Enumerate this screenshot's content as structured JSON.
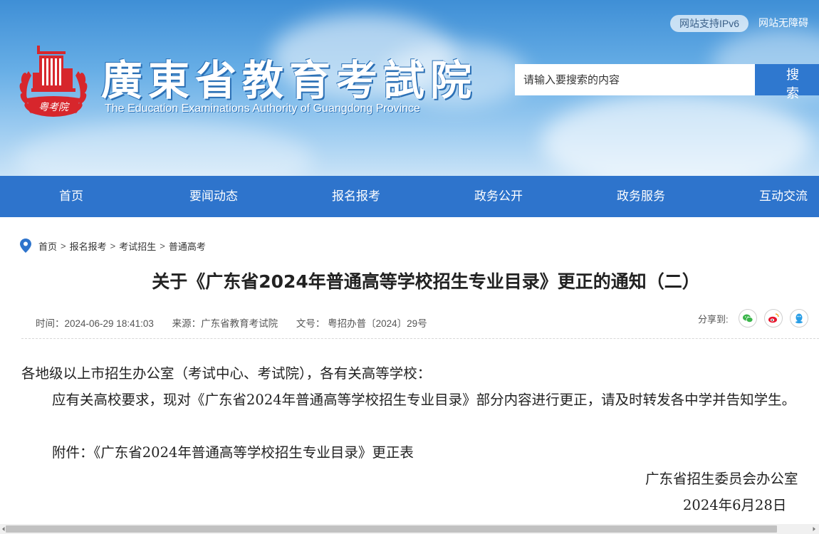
{
  "header": {
    "site_name_cn": "廣東省教育考試院",
    "site_name_en": "The Education Examinations Authority of Guangdong Province",
    "emblem_text": "粤考院",
    "ipv6_label": "网站支持IPv6",
    "accessibility_label": "网站无障碍",
    "search_placeholder": "请输入要搜索的内容",
    "search_button": "搜 索"
  },
  "nav": {
    "items": [
      "首页",
      "要闻动态",
      "报名报考",
      "政务公开",
      "政务服务",
      "互动交流"
    ]
  },
  "breadcrumb": {
    "items": [
      "首页",
      "报名报考",
      "考试招生",
      "普通高考"
    ],
    "separator": ">"
  },
  "article": {
    "title": "关于《广东省2024年普通高等学校招生专业目录》更正的通知（二）",
    "time": "时间：2024-06-29 18:41:03",
    "source": "来源：广东省教育考试院",
    "doc_no": "文号： 粤招办普〔2024〕29号",
    "share_label": "分享到:",
    "share_icons": [
      "wechat-icon",
      "weibo-icon",
      "qq-icon"
    ],
    "salutation": "各地级以上市招生办公室（考试中心、考试院），各有关高等学校：",
    "paragraph": "应有关高校要求，现对《广东省2024年普通高等学校招生专业目录》部分内容进行更正，请及时转发各中学并告知学生。",
    "attachment": "附件：《广东省2024年普通高等学校招生专业目录》更正表",
    "signature": "广东省招生委员会办公室",
    "date": "2024年6月28日"
  },
  "colors": {
    "nav_bg": "#2e74cc",
    "search_button_bg": "#2f78cf",
    "emblem_red": "#d7262c",
    "wechat_green": "#3ab54a",
    "weibo_red": "#e6162d",
    "qq_blue": "#2a9ee6"
  }
}
